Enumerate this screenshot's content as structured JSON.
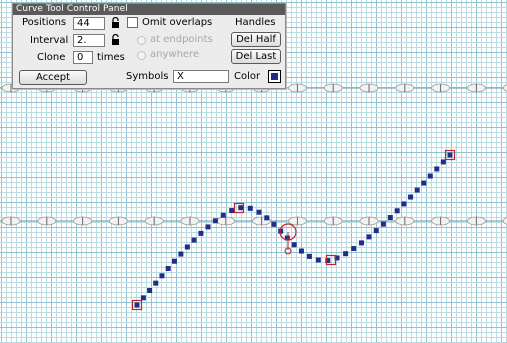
{
  "panel": {
    "title": "Curve Tool Control Panel",
    "positions_label": "Positions",
    "positions_value": "44",
    "omit_overlaps_label": "Omit overlaps",
    "omit_overlaps_checked": false,
    "handles_label": "Handles",
    "interval_label": "Interval",
    "interval_value": "2.",
    "at_endpoints_label": "at endpoints",
    "anywhere_label": "anywhere",
    "del_half_label": "Del Half",
    "clone_label": "Clone",
    "clone_value": "0",
    "times_label": "times",
    "del_last_label": "Del Last",
    "accept_label": "Accept",
    "symbols_label": "Symbols",
    "symbols_value": "X",
    "color_label": "Color",
    "color_value": "#1f2e86"
  },
  "colors": {
    "grid_minor": "#b8dbe4",
    "grid_major": "#8fc3d0",
    "curve_point": "#1f2e86",
    "handle": "#c0232d"
  },
  "icons": [
    "lock-icon",
    "checkbox",
    "radio",
    "color-swatch",
    "handle-marker",
    "pivot-marker"
  ]
}
